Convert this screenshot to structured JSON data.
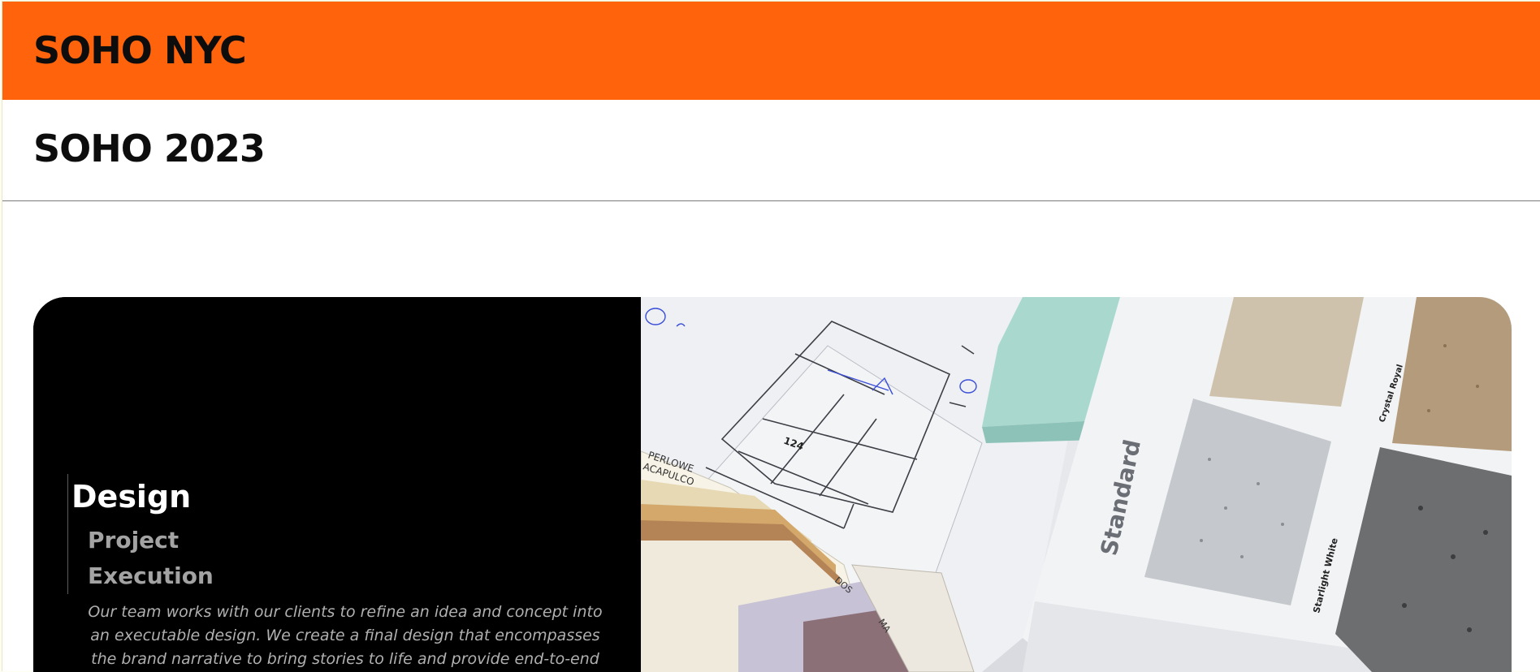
{
  "header": {
    "brand": "SOHO NYC"
  },
  "page": {
    "title": "SOHO 2023"
  },
  "hero": {
    "nav": {
      "active": "Design",
      "items": [
        "Project",
        "Execution"
      ]
    },
    "description": "Our team works with our clients to refine an idea and concept into an executable design. We create a final design that encompasses the brand narrative to bring stories to life and provide end-to-end",
    "image": {
      "labels": {
        "sample_1": "Crystal Royal",
        "sample_2": "Starlight White",
        "board": "Standard",
        "dimension": "124",
        "swatch_1": "PERLOWE",
        "swatch_2": "ACAPULCO",
        "swatch_3": "DOS",
        "swatch_4": "MA"
      }
    }
  },
  "colors": {
    "brand_orange": "#ff640c",
    "hero_background": "#000000",
    "nav_active": "#ffffff",
    "nav_inactive": "#a3a3a3"
  }
}
